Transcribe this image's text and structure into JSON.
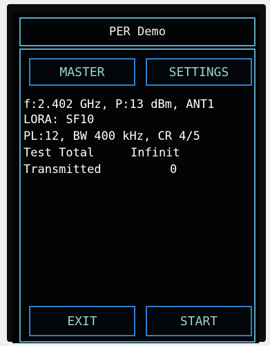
{
  "header": {
    "title": "PER Demo"
  },
  "tabs": {
    "master_label": "MASTER",
    "settings_label": "SETTINGS"
  },
  "info": {
    "radio_line": "f:2.402 GHz, P:13 dBm, ANT1",
    "lora_line": "LORA: SF10",
    "params_line": "PL:12, BW 400 kHz, CR 4/5",
    "test_total_label": "Test Total",
    "test_total_value": "Infinit",
    "transmitted_label": "Transmitted",
    "transmitted_value": "0"
  },
  "footer": {
    "exit_label": "EXIT",
    "start_label": "START"
  },
  "colors": {
    "panel_border": "#5aa7c9",
    "button_border": "#2e7fcc",
    "button_text": "#9ad7c6",
    "background": "#020405",
    "text": "#ffffff"
  }
}
